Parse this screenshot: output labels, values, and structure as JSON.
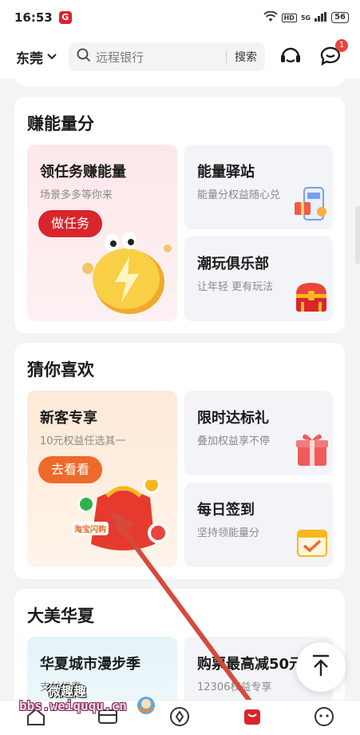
{
  "status": {
    "time": "16:53",
    "app_badge": "G",
    "hd": "HD",
    "net": "5G",
    "battery": "56"
  },
  "header": {
    "city": "东莞",
    "search_placeholder": "远程银行",
    "search_button": "搜索",
    "message_badge": "1"
  },
  "earn": {
    "title": "赚能量分",
    "main_tile": {
      "title": "领任务赚能量",
      "subtitle": "场景多多等你来",
      "button": "做任务"
    },
    "tile_2": {
      "title": "能量驿站",
      "subtitle": "能量分权益随心兑"
    },
    "tile_3": {
      "title": "潮玩俱乐部",
      "subtitle": "让年轻 更有玩法"
    }
  },
  "guess": {
    "title": "猜你喜欢",
    "main_tile": {
      "title": "新客专享",
      "subtitle": "10元权益任选其一",
      "button": "去看看",
      "brand_tag": "淘宝闪购"
    },
    "tile_2": {
      "title": "限时达标礼",
      "subtitle": "叠加权益享不停"
    },
    "tile_3": {
      "title": "每日签到",
      "subtitle": "坚持领能量分"
    }
  },
  "china": {
    "title": "大美华夏",
    "tile_1": {
      "title": "华夏城市漫步季",
      "subtitle": "支付优惠"
    },
    "tile_2": {
      "title": "购票最高减50元",
      "subtitle": "12306权益专享"
    }
  },
  "watermark": {
    "text_cn": "微趣趣",
    "url": "bbs.weiququ.cn"
  },
  "colors": {
    "brand_red": "#d9252c",
    "orange": "#ee6a2a",
    "accent_yellow": "#f6b81e"
  }
}
